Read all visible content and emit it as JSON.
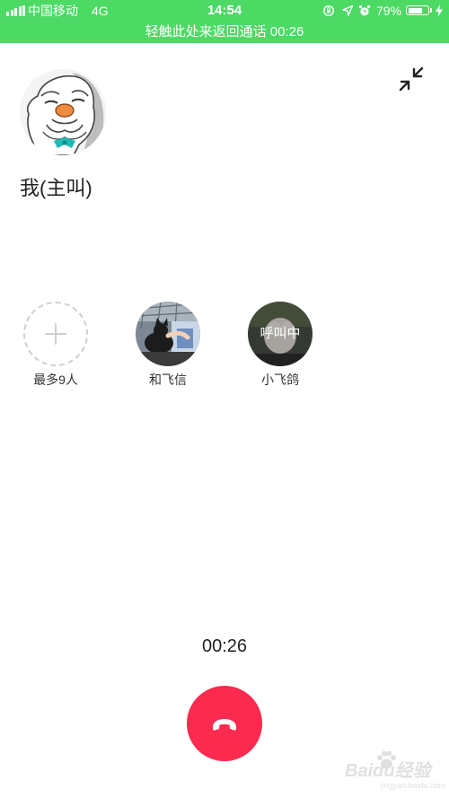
{
  "status_bar": {
    "carrier": "中国移动",
    "network": "4G",
    "time": "14:54",
    "battery_percent": "79%",
    "battery_level": 0.79,
    "icons": [
      "signal-icon",
      "rotation-lock-icon",
      "location-icon",
      "alarm-icon",
      "battery-icon",
      "charging-icon"
    ]
  },
  "call_banner": {
    "text": "轻触此处来返回通话 00:26"
  },
  "caller": {
    "name": "我(主叫)"
  },
  "participants": [
    {
      "label": "最多9人",
      "icon": "add-icon"
    },
    {
      "label": "和飞信"
    },
    {
      "label": "小飞鸽",
      "status": "呼叫中"
    }
  ],
  "call": {
    "duration": "00:26"
  },
  "watermark": {
    "text": "Baidu经验",
    "sub": "jingyan.baidu.com"
  },
  "colors": {
    "status_bar_bg": "#4cd964",
    "hangup": "#fb2a4e"
  }
}
